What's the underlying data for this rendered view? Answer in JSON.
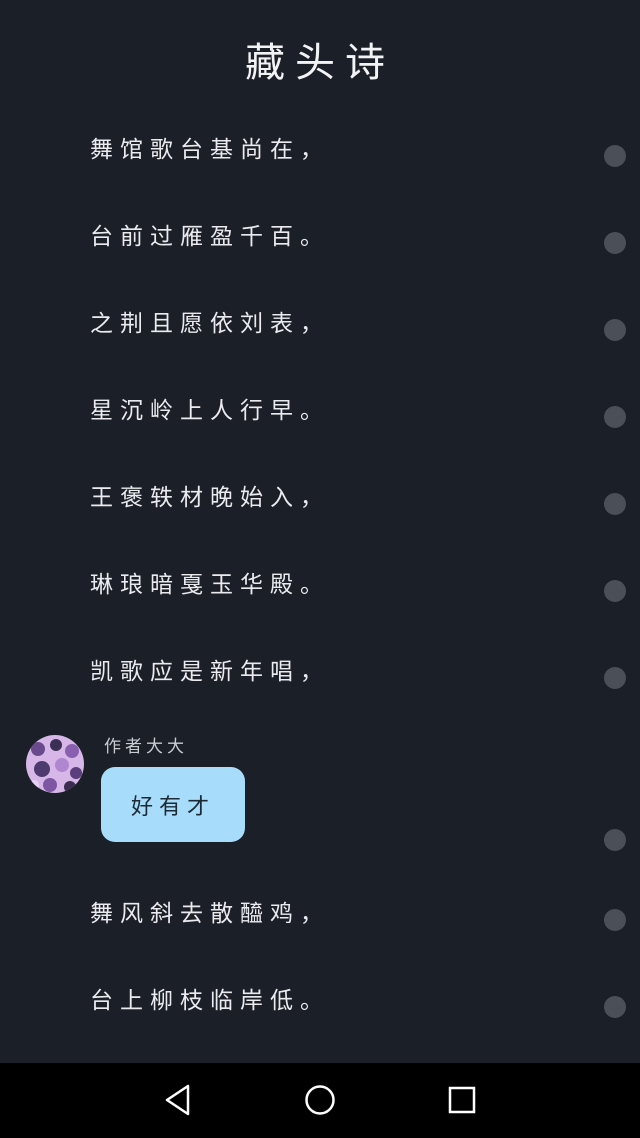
{
  "header": {
    "title": "藏头诗"
  },
  "poem": {
    "lines": [
      "舞馆歌台基尚在，",
      "台前过雁盈千百。",
      "之荆且愿依刘表，",
      "星沉岭上人行早。",
      "王褒轶材晚始入，",
      "琳琅暗戛玉华殿。",
      "凯歌应是新年唱，",
      "舞风斜去散醯鸡，",
      "台上柳枝临岸低。"
    ]
  },
  "comment": {
    "author": "作者大大",
    "text": "好有才",
    "bubble_color": "#a8dcfb"
  },
  "colors": {
    "background": "#1b1f27",
    "dot": "#4a4f58",
    "navbar": "#000000"
  },
  "navbar": {
    "icons": [
      "back-triangle-icon",
      "home-circle-icon",
      "recents-square-icon"
    ]
  }
}
